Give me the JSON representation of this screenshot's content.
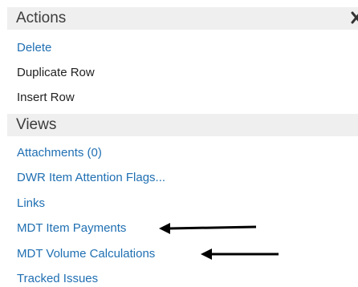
{
  "actions": {
    "header": "Actions",
    "items": [
      {
        "label": "Delete",
        "style": "link"
      },
      {
        "label": "Duplicate Row",
        "style": "plain"
      },
      {
        "label": "Insert Row",
        "style": "plain"
      }
    ]
  },
  "views": {
    "header": "Views",
    "items": [
      {
        "label": "Attachments (0)"
      },
      {
        "label": "DWR Item Attention Flags..."
      },
      {
        "label": "Links"
      },
      {
        "label": "MDT Item Payments"
      },
      {
        "label": "MDT Volume Calculations"
      },
      {
        "label": "Tracked Issues"
      }
    ]
  },
  "icons": {
    "close": "close-icon",
    "annotation_arrows": "left-arrow-icon"
  },
  "colors": {
    "link": "#1f6fb2",
    "header_bg": "#efefef",
    "arrow": "#000000"
  }
}
